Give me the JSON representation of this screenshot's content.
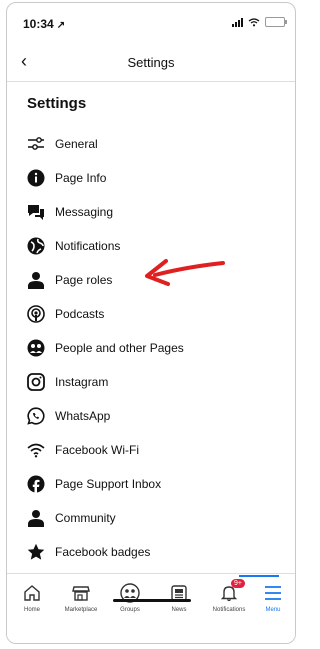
{
  "status": {
    "time": "10:34",
    "location_glyph": "↗"
  },
  "nav": {
    "title": "Settings",
    "back_glyph": "‹"
  },
  "heading": "Settings",
  "items": [
    {
      "label": "General",
      "icon": "sliders-icon"
    },
    {
      "label": "Page Info",
      "icon": "info-icon"
    },
    {
      "label": "Messaging",
      "icon": "chat-icon"
    },
    {
      "label": "Notifications",
      "icon": "globe-icon"
    },
    {
      "label": "Page roles",
      "icon": "person-icon"
    },
    {
      "label": "Podcasts",
      "icon": "podcast-icon"
    },
    {
      "label": "People and other Pages",
      "icon": "people-icon"
    },
    {
      "label": "Instagram",
      "icon": "instagram-icon"
    },
    {
      "label": "WhatsApp",
      "icon": "whatsapp-icon"
    },
    {
      "label": "Facebook Wi-Fi",
      "icon": "wifi-icon"
    },
    {
      "label": "Page Support Inbox",
      "icon": "facebook-icon"
    },
    {
      "label": "Community",
      "icon": "person-icon"
    },
    {
      "label": "Facebook badges",
      "icon": "star-icon"
    }
  ],
  "tabs": [
    {
      "label": "Home",
      "icon": "home-icon"
    },
    {
      "label": "Marketplace",
      "icon": "marketplace-icon"
    },
    {
      "label": "Groups",
      "icon": "groups-icon"
    },
    {
      "label": "News",
      "icon": "news-icon"
    },
    {
      "label": "Notifications",
      "icon": "bell-icon",
      "badge": "9+"
    },
    {
      "label": "Menu",
      "icon": "menu-icon"
    }
  ],
  "colors": {
    "accent": "#1877f2",
    "arrow": "#e02020",
    "badge": "#e41e3f"
  }
}
